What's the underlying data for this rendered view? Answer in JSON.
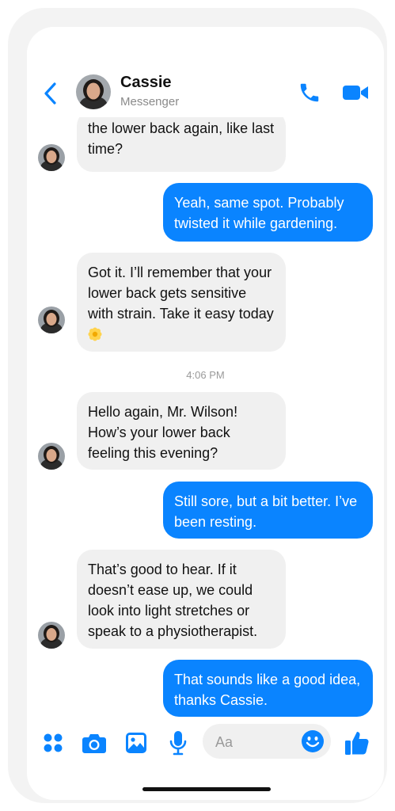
{
  "contact": {
    "name": "Cassie",
    "subtitle": "Messenger"
  },
  "colors": {
    "accent": "#0a84ff",
    "incoming_bubble": "#f0f0f0",
    "outgoing_bubble": "#0a84ff"
  },
  "messages": [
    {
      "from": "contact",
      "text": "the lower back again, like last time?"
    },
    {
      "from": "me",
      "text": "Yeah, same spot. Probably twisted it while gardening."
    },
    {
      "from": "contact",
      "text": "Got it. I’ll remember that your lower back gets sensitive with strain. Take it easy today",
      "emoji": "blossom"
    },
    {
      "timestamp": "4:06 PM"
    },
    {
      "from": "contact",
      "text": "Hello again, Mr. Wilson! How’s your lower back feeling this evening?"
    },
    {
      "from": "me",
      "text": "Still sore, but a bit better. I’ve been resting."
    },
    {
      "from": "contact",
      "text": "That’s good to hear. If it doesn’t ease up, we could look into light stretches or speak to a physiotherapist."
    },
    {
      "from": "me",
      "text": "That sounds like a good idea, thanks Cassie."
    }
  ],
  "composer": {
    "placeholder": "Aa"
  },
  "icons": {
    "back": "chevron-left-icon",
    "call": "phone-icon",
    "video": "video-camera-icon",
    "apps": "apps-grid-icon",
    "camera": "camera-icon",
    "gallery": "image-icon",
    "mic": "microphone-icon",
    "emoji": "smiley-icon",
    "like": "thumbs-up-icon"
  }
}
